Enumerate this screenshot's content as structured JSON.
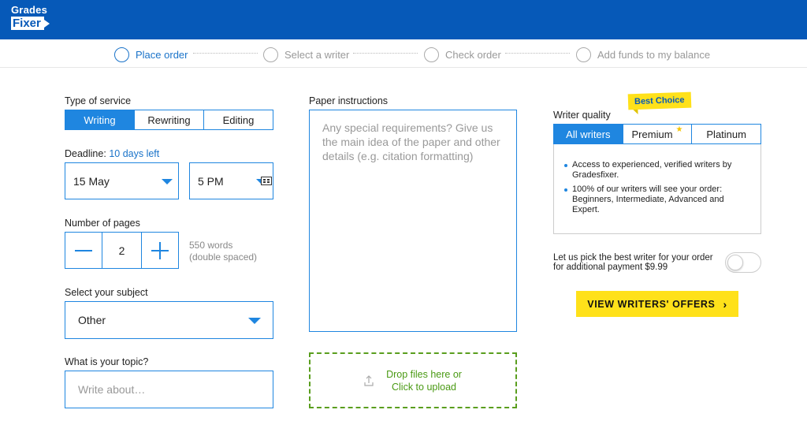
{
  "brand": {
    "line1": "Grades",
    "line2": "Fixer"
  },
  "steps": [
    {
      "label": "Place order"
    },
    {
      "label": "Select a writer"
    },
    {
      "label": "Check order"
    },
    {
      "label": "Add funds to my balance"
    }
  ],
  "service": {
    "label": "Type of service",
    "options": [
      "Writing",
      "Rewriting",
      "Editing"
    ],
    "selected": "Writing"
  },
  "deadline": {
    "label": "Deadline:",
    "left": "10 days left",
    "date": "15 May",
    "time": "5 PM"
  },
  "pages": {
    "label": "Number of pages",
    "value": "2",
    "words": "550 words",
    "spacing": "(double spaced)"
  },
  "subject": {
    "label": "Select your subject",
    "value": "Other"
  },
  "topic": {
    "label": "What is your topic?",
    "placeholder": "Write about…"
  },
  "instructions": {
    "label": "Paper instructions",
    "placeholder": "Any special requirements? Give us the main idea of the paper and other details (e.g. citation formatting)"
  },
  "upload": {
    "line1": "Drop files here or",
    "line2": "Click to upload"
  },
  "writer_quality": {
    "label": "Writer quality",
    "badge": "Best Choice",
    "options": [
      "All writers",
      "Premium",
      "Platinum"
    ],
    "selected": "All writers",
    "bullets": [
      "Access to experienced, verified writers by Gradesfixer.",
      "100% of our writers will see your order: Beginners, Intermediate, Advanced and Expert."
    ]
  },
  "best_writer": {
    "line1": "Let us pick the best writer for your order",
    "line2": "for additional payment $9.99",
    "enabled": false
  },
  "cta": {
    "label": "VIEW WRITERS' OFFERS"
  },
  "colors": {
    "brand": "#0659b8",
    "accent": "#1f86e0",
    "cta": "#ffe11a",
    "upload": "#5a9e1e"
  }
}
